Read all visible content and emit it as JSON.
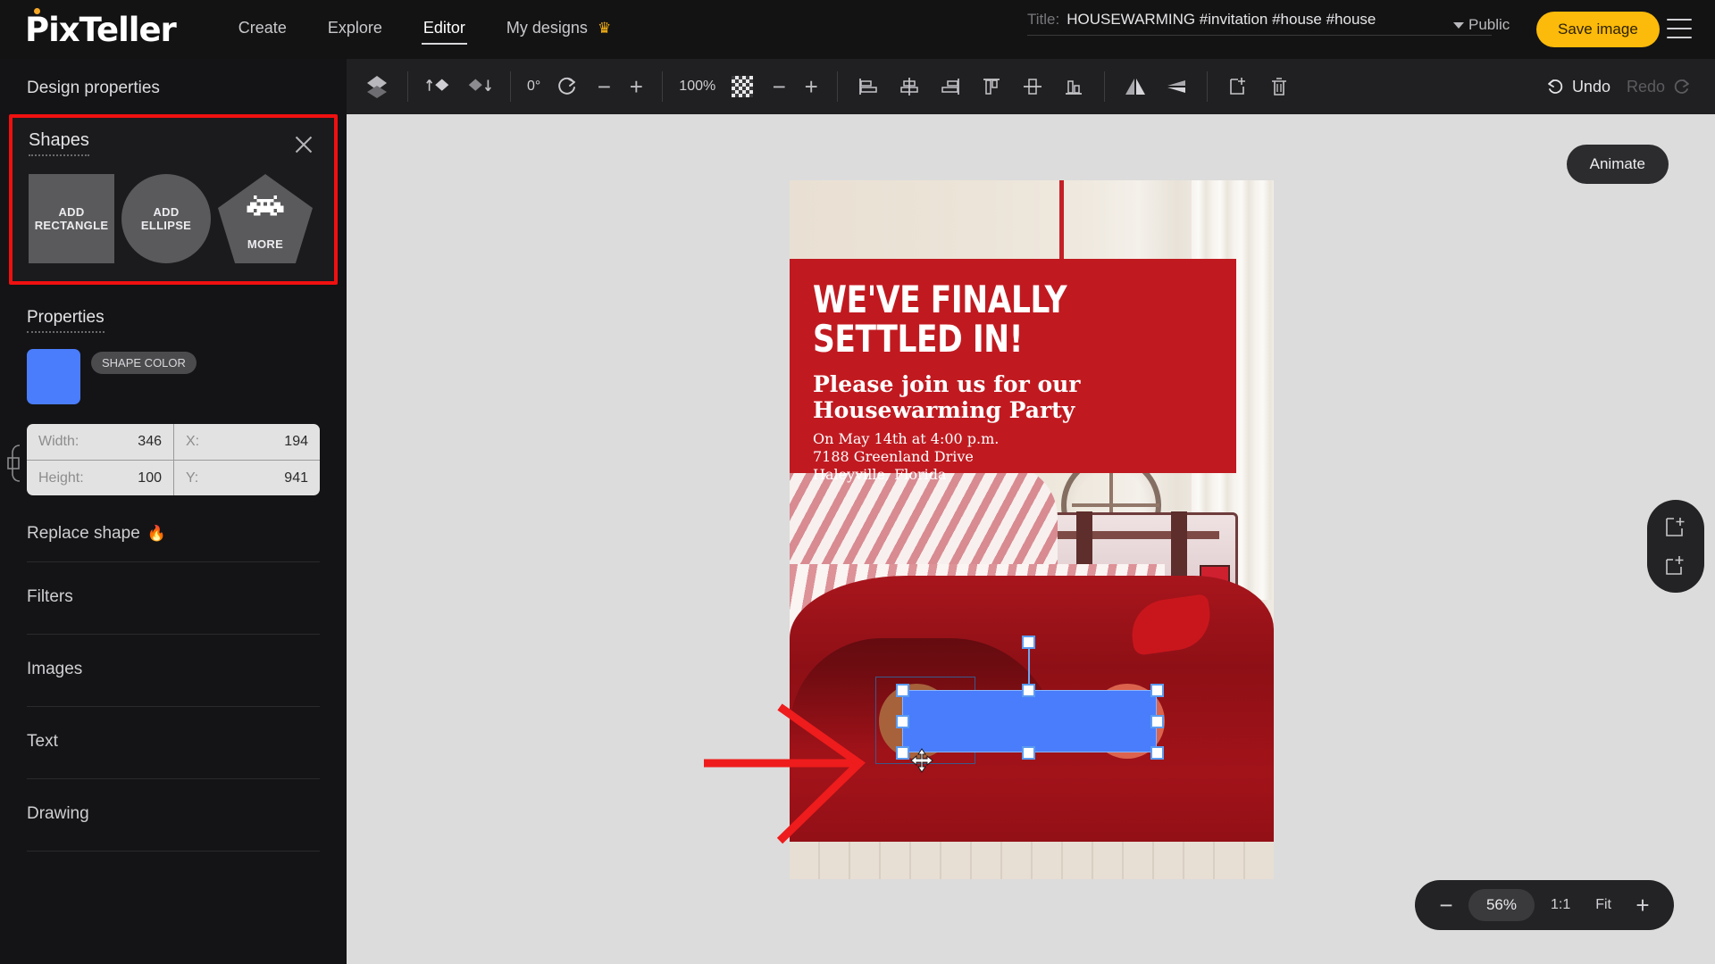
{
  "header": {
    "logo": "PixTeller",
    "nav": [
      {
        "label": "Create",
        "active": false
      },
      {
        "label": "Explore",
        "active": false
      },
      {
        "label": "Editor",
        "active": true
      },
      {
        "label": "My designs",
        "active": false,
        "icon": "crown-icon"
      }
    ],
    "title_label": "Title:",
    "title_value": "HOUSEWARMING #invitation #house #house",
    "visibility": "Public",
    "save_label": "Save image",
    "menu_icon": "hamburger-icon"
  },
  "toolbar": {
    "layers_icon": "layers-icon",
    "bring_forward_icon": "bring-forward-icon",
    "send_backward_icon": "send-backward-icon",
    "rotation_value": "0°",
    "rotation_icon": "rotate-icon",
    "rotation_minus": "−",
    "rotation_plus": "+",
    "opacity_value": "100%",
    "opacity_icon": "checker-opacity-icon",
    "opacity_minus": "−",
    "opacity_plus": "+",
    "align_icons": [
      "align-left-icon",
      "align-center-h-icon",
      "align-right-icon",
      "align-top-icon",
      "align-middle-v-icon",
      "align-bottom-icon"
    ],
    "flip_horizontal_icon": "flip-horizontal-icon",
    "flip_vertical_icon": "flip-vertical-icon",
    "duplicate_icon": "duplicate-icon",
    "delete_icon": "trash-icon",
    "undo_label": "Undo",
    "redo_label": "Redo",
    "undo_enabled": true,
    "redo_enabled": false
  },
  "sidebar": {
    "heading": "Design properties",
    "shapes_panel": {
      "title": "Shapes",
      "close_icon": "close-icon",
      "highlight_color": "#f01010",
      "buttons": [
        {
          "label_line1": "ADD",
          "label_line2": "RECTANGLE",
          "icon": "rectangle-icon"
        },
        {
          "label_line1": "ADD",
          "label_line2": "ELLIPSE",
          "icon": "ellipse-icon"
        },
        {
          "label_line1": "MORE",
          "label_line2": "",
          "icon": "pentagon-invader-icon"
        }
      ]
    },
    "properties": {
      "title": "Properties",
      "shape_color_tag": "SHAPE COLOR",
      "shape_color": "#4a7dfb",
      "fields": [
        {
          "label": "Width:",
          "value": "346"
        },
        {
          "label": "X:",
          "value": "194"
        },
        {
          "label": "Height:",
          "value": "100"
        },
        {
          "label": "Y:",
          "value": "941"
        }
      ],
      "link_icon": "link-ratio-icon"
    },
    "menu": [
      {
        "label": "Replace shape",
        "icon": "fire-icon",
        "fire": "🔥"
      },
      {
        "label": "Filters",
        "icon": null,
        "fire": ""
      },
      {
        "label": "Images",
        "icon": null,
        "fire": ""
      },
      {
        "label": "Text",
        "icon": null,
        "fire": ""
      },
      {
        "label": "Drawing",
        "icon": null,
        "fire": ""
      }
    ]
  },
  "canvas": {
    "animate_label": "Animate",
    "add_frame_icon": "add-frame-icon",
    "duplicate_frame_icon": "duplicate-frame-icon",
    "annotation_arrow": "red-arrow-annotation",
    "poster": {
      "headline_line1": "WE'VE FINALLY",
      "headline_line2": "SETTLED IN!",
      "subhead_line1": "Please join us for our",
      "subhead_line2": "Housewarming Party",
      "detail_line1": "On May 14th at 4:00 p.m.",
      "detail_line2": "7188 Greenland Drive",
      "detail_line3": "Haleyville, Florida",
      "banner_color": "#c01a20"
    },
    "selection": {
      "shape_color": "#4a7dfb",
      "handle_count": 8,
      "rotation_handle": true,
      "cursor": "move-cursor",
      "left_circle_color": "#a9693f",
      "right_circle_color": "#df6850"
    }
  },
  "zoom_bar": {
    "minus": "−",
    "level": "56%",
    "one_to_one": "1:1",
    "fit": "Fit",
    "plus": "+"
  }
}
